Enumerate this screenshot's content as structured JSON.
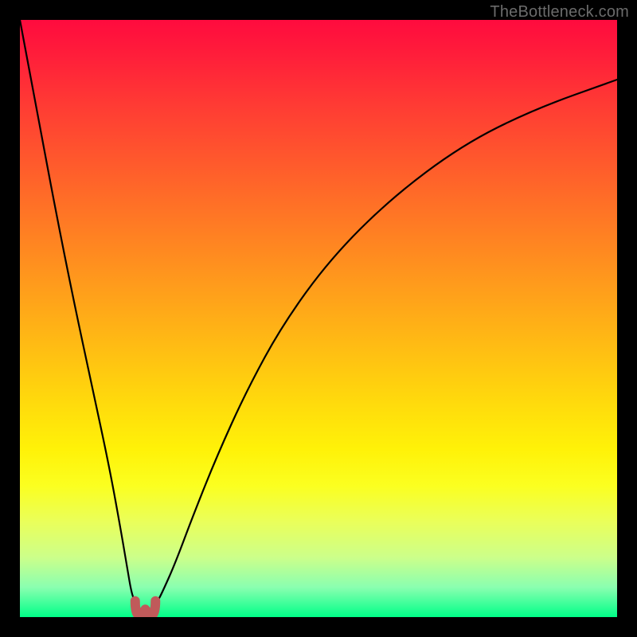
{
  "watermark": {
    "text": "TheBottleneck.com"
  },
  "chart_data": {
    "type": "line",
    "title": "",
    "xlabel": "",
    "ylabel": "",
    "xlim": [
      0,
      100
    ],
    "ylim": [
      0,
      100
    ],
    "grid": false,
    "legend": false,
    "background": "red-to-green vertical gradient",
    "series": [
      {
        "name": "left-branch",
        "x": [
          0,
          3,
          6,
          9,
          12,
          15,
          17,
          18,
          18.7,
          19.3,
          20
        ],
        "y": [
          100,
          84,
          68,
          53,
          39,
          25,
          14,
          8,
          4,
          2.5,
          1.6
        ]
      },
      {
        "name": "right-branch",
        "x": [
          22,
          23,
          24,
          26,
          29,
          33,
          38,
          44,
          52,
          62,
          74,
          86,
          100
        ],
        "y": [
          1.6,
          2.5,
          4.5,
          9,
          17,
          27,
          38,
          49,
          60,
          70,
          79,
          85,
          90
        ]
      },
      {
        "name": "valley-marker",
        "x": [
          19.3,
          20,
          21,
          22,
          22.7
        ],
        "y": [
          2.7,
          1.6,
          2.1,
          1.6,
          2.7
        ]
      }
    ],
    "annotations": {
      "valley_x": 21,
      "valley_y": 1.6,
      "note": "V-shaped curve with minimum near x≈21; values estimated from axes-less gradient plot"
    }
  }
}
